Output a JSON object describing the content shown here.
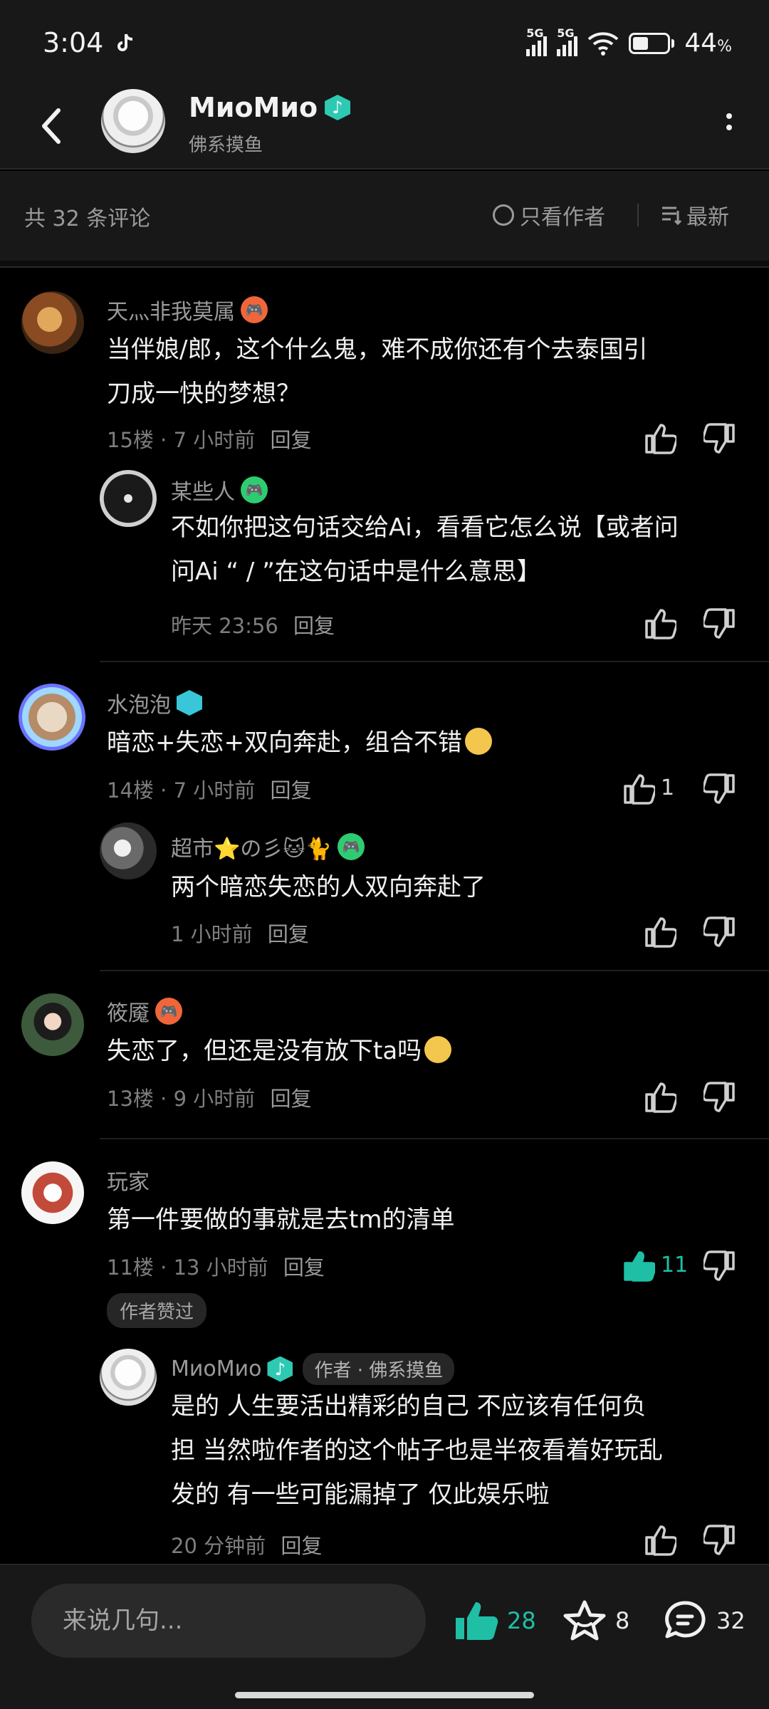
{
  "status_bar": {
    "time": "3:04",
    "network1": "5G",
    "network2": "5G",
    "battery": "44",
    "battery_unit": "%",
    "battery_level": 0.44
  },
  "header": {
    "name": "MиoMиo",
    "subtitle": "佛系摸鱼"
  },
  "filter": {
    "count": "共 32 条评论",
    "author_only": "只看作者",
    "sort": "最新"
  },
  "comments": [
    {
      "user": "天灬非我莫属",
      "lines": [
        "当伴娘/郎，这个什么鬼，难不成你还有个去泰国引",
        "刀成一快的梦想？"
      ],
      "floor": "15楼",
      "time": "7 小时前",
      "reply": "回复",
      "likes": ""
    },
    {
      "user": "某些人",
      "lines": [
        "不如你把这句话交给Ai，看看它怎么说【或者问",
        "问Ai “ / ”在这句话中是什么意思】"
      ],
      "time": "昨天 23:56",
      "reply": "回复",
      "likes": ""
    },
    {
      "user": "水泡泡",
      "lines": [
        "暗恋+失恋+双向奔赴，组合不错"
      ],
      "floor": "14楼",
      "time": "7 小时前",
      "reply": "回复",
      "likes": "1"
    },
    {
      "user": "超市⭐の彡🐱🐈",
      "lines": [
        "两个暗恋失恋的人双向奔赴了"
      ],
      "time": "1 小时前",
      "reply": "回复",
      "likes": ""
    },
    {
      "user": "筱魇",
      "lines": [
        "失恋了，但还是没有放下ta吗"
      ],
      "floor": "13楼",
      "time": "9 小时前",
      "reply": "回复",
      "likes": ""
    },
    {
      "user": "玩家",
      "lines": [
        "第一件要做的事就是去tm的清单"
      ],
      "floor": "11楼",
      "time": "13 小时前",
      "reply": "回复",
      "likes": "11",
      "tag": "作者赞过"
    },
    {
      "user": "MиoMиo",
      "author_tag": "作者 · 佛系摸鱼",
      "lines": [
        "是的 人生要活出精彩的自己 不应该有任何负",
        "担 当然啦作者的这个帖子也是半夜看着好玩乱",
        "发的 有一些可能漏掉了 仅此娱乐啦"
      ],
      "time": "20 分钟前",
      "reply": "回复",
      "likes": ""
    }
  ],
  "bottom": {
    "input_placeholder": "来说几句...",
    "likes": "28",
    "favorites": "8",
    "comments": "32"
  },
  "colors": {
    "accent": "#1fbfa6",
    "background": "#000000",
    "panel": "#181818"
  },
  "icons": [
    "back-icon",
    "more-icon",
    "thumb-up-icon",
    "thumb-down-icon",
    "star-icon",
    "comment-icon"
  ]
}
